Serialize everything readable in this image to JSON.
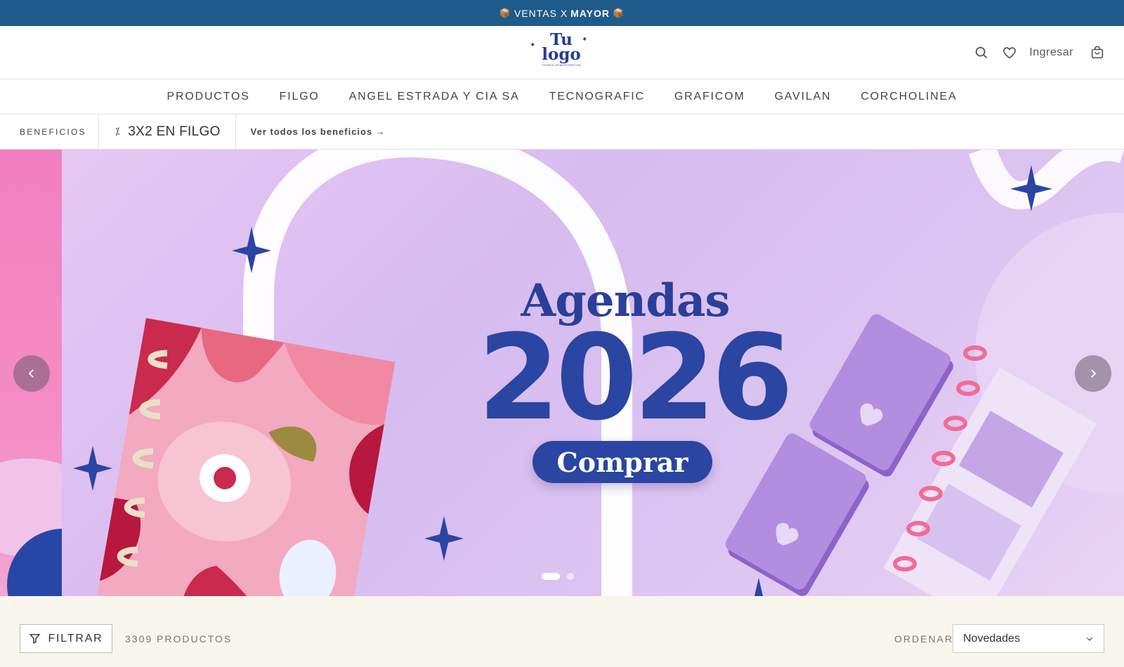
{
  "announcement": {
    "box_emoji": "📦",
    "text": "VENTAS X",
    "strong": "MAYOR"
  },
  "header": {
    "logo": {
      "line1": "Tu",
      "line2": "logo",
      "tagline": "TIENDA DEMOSTRATIVA"
    },
    "login_label": "Ingresar",
    "icons": [
      "search-icon",
      "heart-icon",
      "cart-icon"
    ]
  },
  "nav": {
    "items": [
      {
        "label": "PRODUCTOS"
      },
      {
        "label": "FILGO"
      },
      {
        "label": "ANGEL ESTRADA Y CIA SA"
      },
      {
        "label": "TECNOGRAFIC"
      },
      {
        "label": "GRAFICOM"
      },
      {
        "label": "GAVILAN"
      },
      {
        "label": "CORCHOLINEA"
      }
    ]
  },
  "benefits": {
    "label": "BENEFICIOS",
    "item": {
      "icon": "percent-icon",
      "text": "3X2 EN FILGO"
    },
    "link": "Ver todos los beneficios →"
  },
  "hero": {
    "title": "Agendas",
    "year": "2026",
    "cta": "Comprar",
    "slides": 2,
    "active_slide": 1
  },
  "toolbar": {
    "filter_label": "FILTRAR",
    "product_count": "3309 PRODUCTOS",
    "sort_label": "ORDENAR",
    "sort_value": "Novedades"
  },
  "colors": {
    "announcement_bg": "#1f5b8a",
    "brand_blue": "#2a45a2",
    "toolbar_bg": "#f8f5ec"
  }
}
